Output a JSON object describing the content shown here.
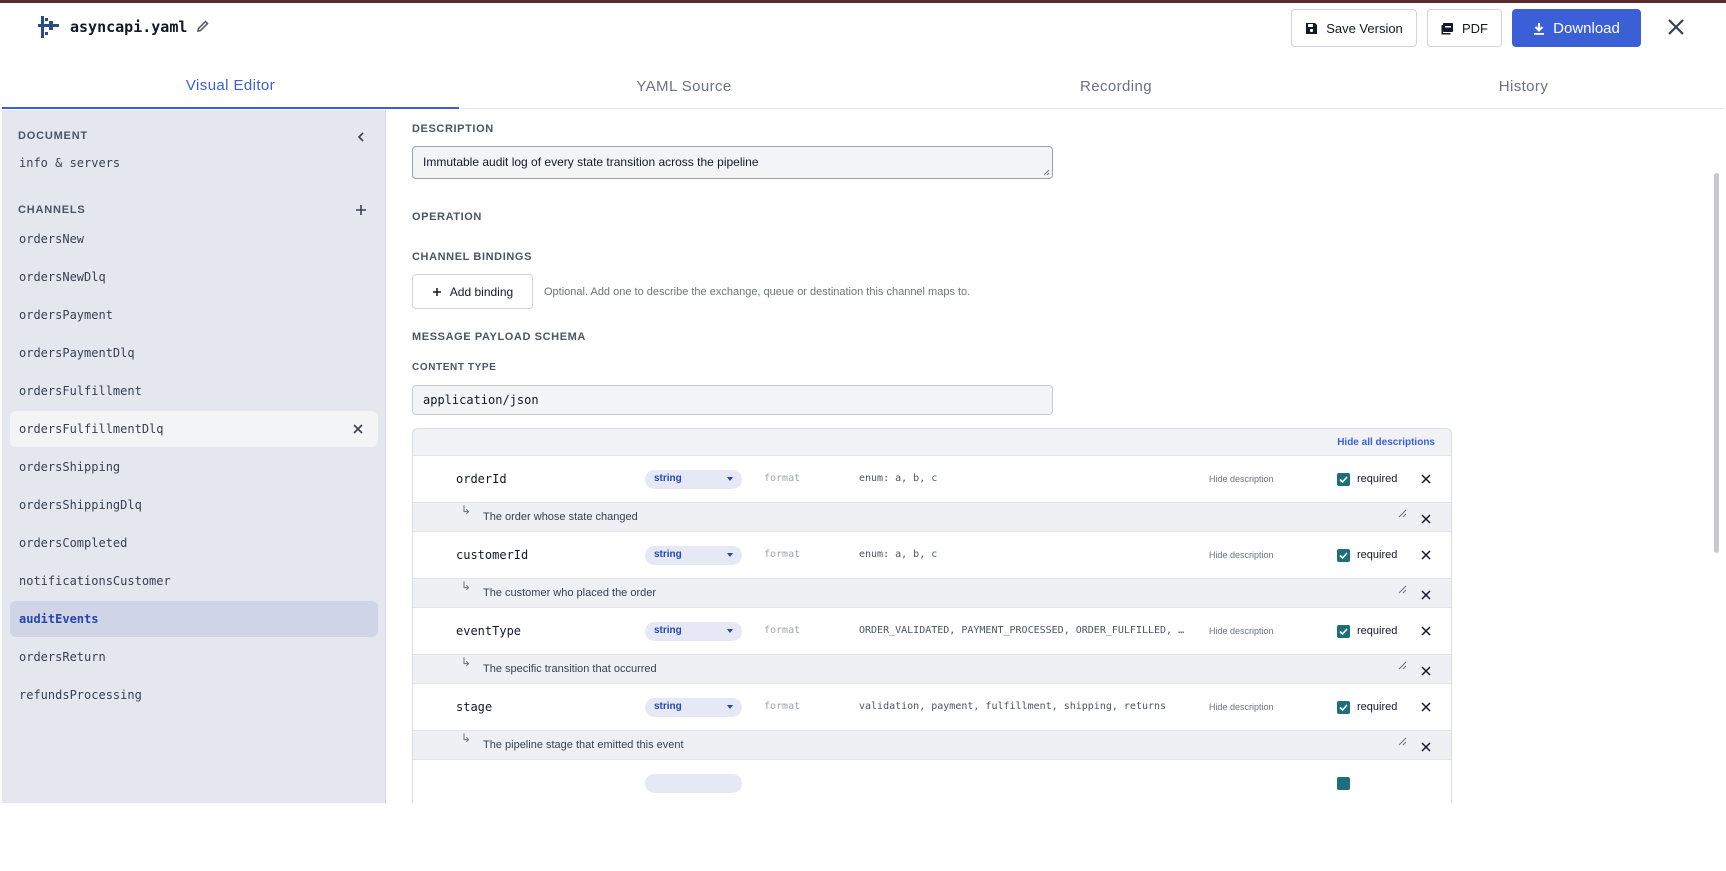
{
  "header": {
    "filename": "asyncapi.yaml",
    "save_label": "Save Version",
    "pdf_label": "PDF",
    "download_label": "Download"
  },
  "tabs": [
    {
      "label": "Visual Editor",
      "active": true
    },
    {
      "label": "YAML Source",
      "active": false
    },
    {
      "label": "Recording",
      "active": false
    },
    {
      "label": "History",
      "active": false
    }
  ],
  "sidebar": {
    "document_heading": "DOCUMENT",
    "info_item": "info & servers",
    "channels_heading": "CHANNELS",
    "channels": [
      "ordersNew",
      "ordersNewDlq",
      "ordersPayment",
      "ordersPaymentDlq",
      "ordersFulfillment",
      "ordersFulfillmentDlq",
      "ordersShipping",
      "ordersShippingDlq",
      "ordersCompleted",
      "notificationsCustomer",
      "auditEvents",
      "ordersReturn",
      "refundsProcessing"
    ],
    "selected_channel": "auditEvents",
    "hovered_channel": "ordersFulfillmentDlq"
  },
  "main": {
    "description_label": "DESCRIPTION",
    "description_value": "Immutable audit log of every state transition across the pipeline",
    "operation_label": "OPERATION",
    "channel_bindings_label": "CHANNEL BINDINGS",
    "add_binding_label": "Add binding",
    "binding_hint": "Optional. Add one to describe the exchange, queue or destination this channel maps to.",
    "payload_label": "MESSAGE PAYLOAD SCHEMA",
    "content_type_label": "CONTENT TYPE",
    "content_type_value": "application/json",
    "hide_all_label": "Hide all descriptions"
  },
  "properties": [
    {
      "name": "orderId",
      "type": "string",
      "format": "format",
      "enum": "enum: a, b, c",
      "hide_label": "Hide description",
      "required_label": "required",
      "required": true,
      "description": "The order whose state changed"
    },
    {
      "name": "customerId",
      "type": "string",
      "format": "format",
      "enum": "enum: a, b, c",
      "hide_label": "Hide description",
      "required_label": "required",
      "required": true,
      "description": "The customer who placed the order"
    },
    {
      "name": "eventType",
      "type": "string",
      "format": "format",
      "enum": "ORDER_VALIDATED, PAYMENT_PROCESSED, ORDER_FULFILLED, ORDER_SHIPPED",
      "hide_label": "Hide description",
      "required_label": "required",
      "required": true,
      "description": "The specific transition that occurred"
    },
    {
      "name": "stage",
      "type": "string",
      "format": "format",
      "enum": "validation, payment, fulfillment, shipping, returns",
      "hide_label": "Hide description",
      "required_label": "required",
      "required": true,
      "description": "The pipeline stage that emitted this event"
    }
  ],
  "colors": {
    "accent": "#3b5fd6",
    "sidebar_bg": "#e5e7ef",
    "active_item_bg": "#cfd4e6",
    "checkbox": "#1f6f7a"
  }
}
